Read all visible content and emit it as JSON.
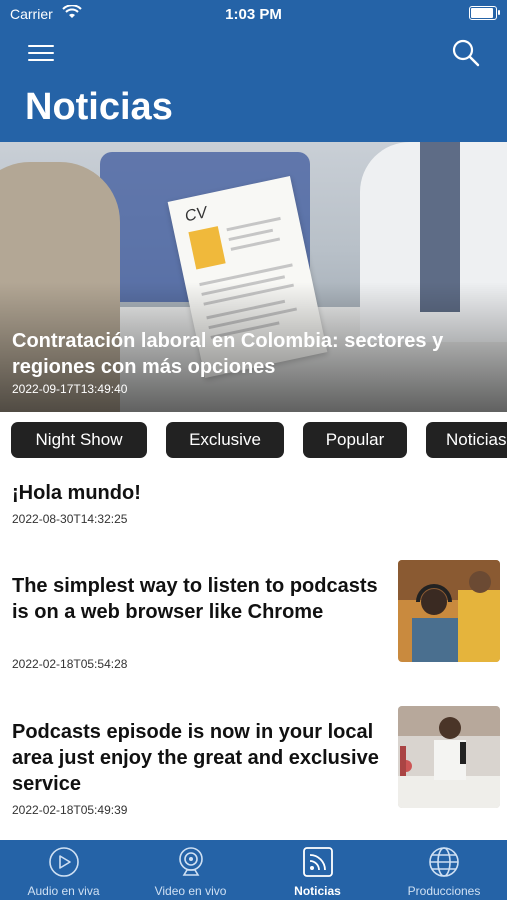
{
  "status_bar": {
    "carrier": "Carrier",
    "time": "1:03 PM"
  },
  "header": {
    "title": "Noticias",
    "menu_icon": "hamburger-menu-icon",
    "search_icon": "search-icon"
  },
  "featured": {
    "title": "Contratación laboral en Colombia: sectores y regiones con más opciones",
    "date": "2022-09-17T13:49:40",
    "image_text": "CV"
  },
  "categories": [
    "Night Show",
    "Exclusive",
    "Popular",
    "Noticias"
  ],
  "articles": [
    {
      "title": "¡Hola mundo!",
      "date": "2022-08-30T14:32:25"
    },
    {
      "title": "The simplest way to listen to podcasts is on a web browser like Chrome",
      "date": "2022-02-18T05:54:28"
    },
    {
      "title": "Podcasts episode is now in your local area just enjoy the great and exclusive service",
      "date": "2022-02-18T05:49:39"
    }
  ],
  "tabbar": {
    "items": [
      {
        "label": "Audio en viva",
        "icon": "play-circle-icon"
      },
      {
        "label": "Video en vivo",
        "icon": "webcam-icon"
      },
      {
        "label": "Noticias",
        "icon": "news-feed-icon",
        "active": true
      },
      {
        "label": "Producciones",
        "icon": "globe-icon"
      }
    ]
  },
  "colors": {
    "primary": "#2563a7",
    "chip_bg": "#222222",
    "text": "#111111"
  }
}
